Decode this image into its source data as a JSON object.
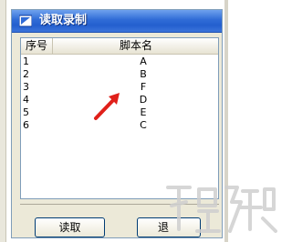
{
  "window": {
    "title": "读取录制"
  },
  "list": {
    "columns": [
      "序号",
      "脚本名"
    ],
    "rows": [
      {
        "num": "1",
        "name": "A"
      },
      {
        "num": "2",
        "name": "B"
      },
      {
        "num": "3",
        "name": "F"
      },
      {
        "num": "4",
        "name": "D"
      },
      {
        "num": "5",
        "name": "E"
      },
      {
        "num": "6",
        "name": "C"
      }
    ]
  },
  "buttons": {
    "read_label": "读取",
    "exit_label": "退"
  },
  "icons": {
    "title_icon": "window-app-icon",
    "annotation_arrow": "red-arrow-icon",
    "watermark": "xiazaiba-watermark"
  },
  "colors": {
    "titlebar": "#2f6bd6",
    "arrow": "#e0201a"
  }
}
